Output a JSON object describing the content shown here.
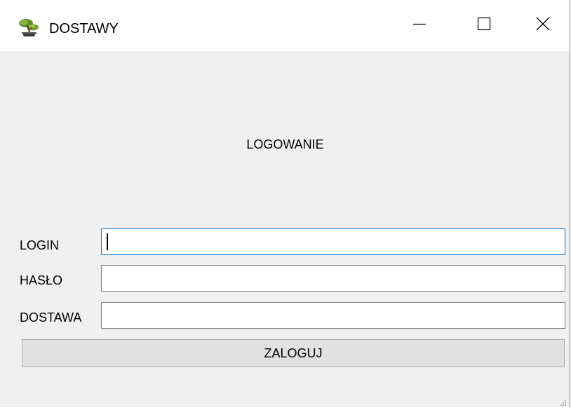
{
  "window": {
    "title": "DOSTAWY",
    "app_icon": "bonsai-tree-icon",
    "controls": {
      "minimize_icon": "minimize-icon",
      "maximize_icon": "maximize-icon",
      "close_icon": "close-icon"
    }
  },
  "form": {
    "heading": "LOGOWANIE",
    "fields": {
      "login": {
        "label": "LOGIN",
        "value": "",
        "focused": true
      },
      "haslo": {
        "label": "HASŁO",
        "value": ""
      },
      "dostawa": {
        "label": "DOSTAWA",
        "value": ""
      }
    },
    "submit_label": "ZALOGUJ"
  },
  "colors": {
    "background": "#f0f0f0",
    "titlebar": "#ffffff",
    "focus_border": "#0078d7",
    "input_border": "#7a7a7a",
    "button_bg": "#e1e1e1",
    "button_border": "#adadad"
  }
}
